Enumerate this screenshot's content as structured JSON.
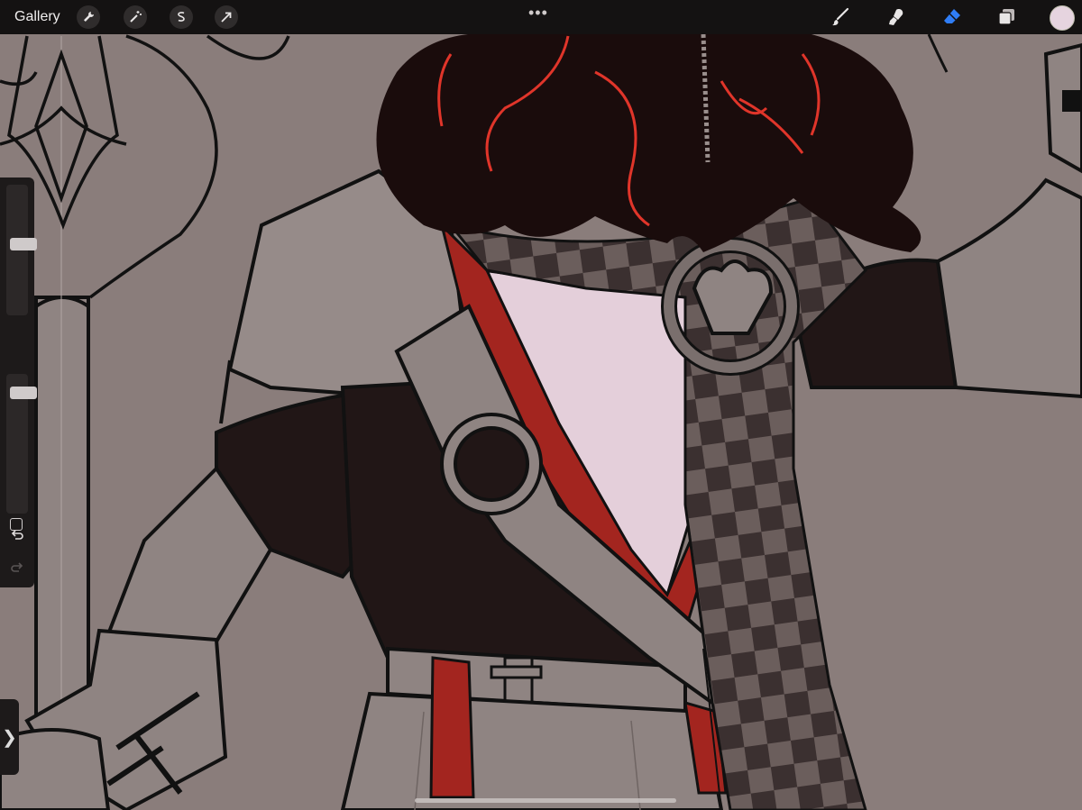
{
  "toolbar": {
    "gallery_label": "Gallery",
    "left_tools": [
      "wrench-icon",
      "magic-wand-icon",
      "selection-s-icon",
      "transform-arrow-icon"
    ],
    "more_dots": "•••",
    "right_tools": [
      "brush-icon",
      "smudge-icon",
      "eraser-icon",
      "layers-icon"
    ],
    "active_tool": "eraser-icon",
    "active_color": "#e6d4df",
    "accent_color": "#2f7df6"
  },
  "sidebar": {
    "brush_size_level": 0.3,
    "opacity_level": 0.0,
    "undo_icon": "undo-icon",
    "redo_icon": "redo-icon",
    "expand_glyph": "❯"
  },
  "canvas": {
    "background": "#8a7d7b",
    "colors": {
      "hair": "#1a0c0c",
      "hair_highlight": "#e0352a",
      "strap_red": "#a3251f",
      "shirt": "#e4cfda",
      "dark_cloth": "#211616",
      "armor": "#8f8482",
      "check_dark": "#3b3030",
      "check_light": "#6b5e5c"
    }
  }
}
